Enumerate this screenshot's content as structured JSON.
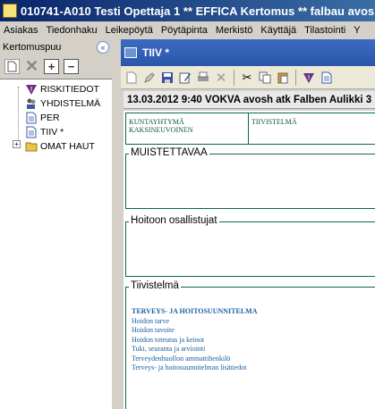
{
  "window": {
    "title": "010741-A010 Testi Opettaja 1  ** EFFICA Kertomus **  falbau avosh"
  },
  "menu": [
    "Asiakas",
    "Tiedonhaku",
    "Leikepöytä",
    "Pöytäpinta",
    "Merkistö",
    "Käyttäjä",
    "Tilastointi",
    "Y"
  ],
  "left_panel": {
    "title": "Kertomuspuu",
    "collapse_symbol": "«",
    "tree": [
      {
        "label": "RISKITIEDOT",
        "icon": "warning-triangle-icon"
      },
      {
        "label": "YHDISTELMÄ",
        "icon": "people-icon"
      },
      {
        "label": "PER",
        "icon": "document-icon"
      },
      {
        "label": "TIIV *",
        "icon": "document-icon"
      },
      {
        "label": "OMAT HAUT",
        "icon": "folder-icon"
      }
    ]
  },
  "document": {
    "tab_title": "TIIV *",
    "header": "13.03.2012 9:40 VOKVA avosh atk Falben Aulikki 3",
    "cell_left": "KUNTAYHTYMÄ KAKSINEUVOINEN",
    "cell_right": "TIIVISTELMÄ",
    "sections": {
      "muistettavaa": "MUISTETTAVAA",
      "hoitoon": "Hoitoon osallistujat",
      "tiivistelma": "Tiivistelmä"
    },
    "summary_lines": [
      "TERVEYS- JA HOITOSUUNNITELMA",
      "Hoidon tarve",
      "Hoidon tavoite",
      "Hoidon toteutus ja keinot",
      "Tuki, seuranta ja arviointi",
      "Terveydenhuollon ammattihenkilö",
      "Terveys- ja hoitosuunnitelman lisätiedot"
    ]
  },
  "colors": {
    "title_gradient_start": "#0a246a",
    "tab_blue": "#2b56a8",
    "form_green": "#0a6a4a",
    "summary_blue": "#1a5fa0"
  }
}
